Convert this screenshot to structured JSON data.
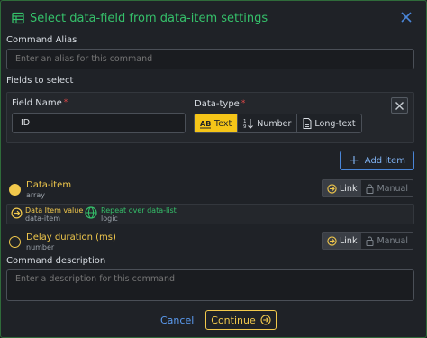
{
  "dialog": {
    "title": "Select data-field from data-item settings",
    "icons": {
      "title": "table-icon",
      "close": "close-icon"
    }
  },
  "command_alias": {
    "label": "Command Alias",
    "placeholder": "Enter an alias for this command",
    "value": ""
  },
  "fields": {
    "section_label": "Fields to select",
    "field_name_label": "Field Name",
    "field_name_value": "ID",
    "required_mark": "*",
    "datatype_label": "Data-type",
    "datatype_options": [
      {
        "label": "Text",
        "icon": "text-type-icon",
        "selected": true
      },
      {
        "label": "Number",
        "icon": "number-sort-icon",
        "selected": false
      },
      {
        "label": "Long-text",
        "icon": "document-icon",
        "selected": false
      }
    ],
    "add_item_label": "Add item"
  },
  "data_item": {
    "title": "Data-item",
    "subtitle": "array",
    "link_label": "Link",
    "manual_label": "Manual",
    "mode": "Link",
    "chips": [
      {
        "title": "Data Item value",
        "subtitle": "data-item",
        "color": "#f2c94c",
        "icon": "link-circle-icon"
      },
      {
        "title": "Repeat over data-list",
        "subtitle": "logic",
        "color": "#35c06a",
        "icon": "globe-icon"
      }
    ]
  },
  "delay": {
    "title": "Delay duration (ms)",
    "subtitle": "number",
    "link_label": "Link",
    "manual_label": "Manual",
    "mode": "Link"
  },
  "description": {
    "label": "Command description",
    "placeholder": "Enter a description for this command"
  },
  "footer": {
    "cancel_label": "Cancel",
    "continue_label": "Continue"
  },
  "colors": {
    "accent_green": "#35c06a",
    "accent_yellow": "#f2c94c",
    "accent_blue": "#5b9bf0",
    "background": "#1f2227",
    "required": "#e04848"
  }
}
